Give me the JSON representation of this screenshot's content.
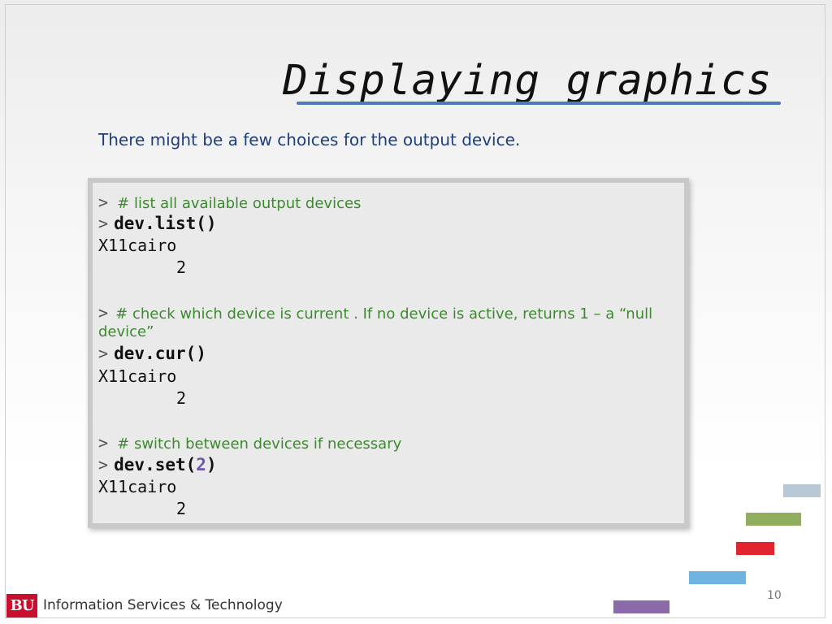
{
  "slide": {
    "title": "Displaying graphics",
    "subtitle": "There might be a few choices for the output device.",
    "page_number": "10"
  },
  "code": {
    "prompt": ">",
    "block1": {
      "comment": "# list all available output devices",
      "command": "dev.list()",
      "output_name": "X11cairo",
      "output_value": "2"
    },
    "block2": {
      "comment_line1": "# check which device is current . If no device is active, returns 1 – a “null",
      "comment_line2": "device”",
      "command": "dev.cur()",
      "output_name": "X11cairo",
      "output_value": "2"
    },
    "block3": {
      "comment": "# switch between devices if necessary",
      "command_prefix": "dev.set(",
      "command_arg": "2",
      "command_suffix": ")",
      "output_name": "X11cairo",
      "output_value": "2"
    }
  },
  "footer": {
    "logo_text": "BU",
    "org_name": "Information Services & Technology"
  },
  "colors": {
    "title_underline": "#4d7ab8",
    "subtitle": "#1f3f7a",
    "comment": "#3c8a2e",
    "logo": "#c8102e",
    "deco_bars": [
      "#b7c9d6",
      "#8fad5a",
      "#e0252f",
      "#6fb4e0",
      "#8a6aa8"
    ]
  }
}
